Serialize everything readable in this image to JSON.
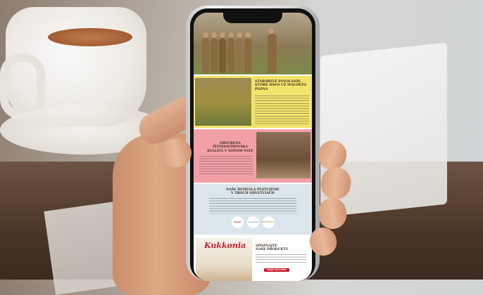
{
  "app": {
    "brand": "Kukkonia",
    "accent": "#c61f2b"
  },
  "sections": {
    "heritage": {
      "title_l1": "STAROBYLÉ POVOLANIE,",
      "title_l2": "KTORÉ DNES UŽ MÁLOKTO",
      "title_l3": "POZNÁ"
    },
    "quality": {
      "title_l1": "OBĽÚBENÁ",
      "title_l2": "ŽITNOOSTROVSKÁ",
      "title_l3": "KVALITA V NOVOM ŠATE"
    },
    "craft": {
      "title_l1": "NAŠE REMESLÁ PESTUJEME",
      "title_l2": "V TROCH ODVETVIACH",
      "circles": [
        "MÄSO",
        "MLIEKO",
        "ZELENINA"
      ]
    },
    "products": {
      "title_l1": "SPOZNAJTE",
      "title_l2": "NAŠE PRODUKTY",
      "button": "PREJSŤ NA E-SHOP"
    }
  }
}
